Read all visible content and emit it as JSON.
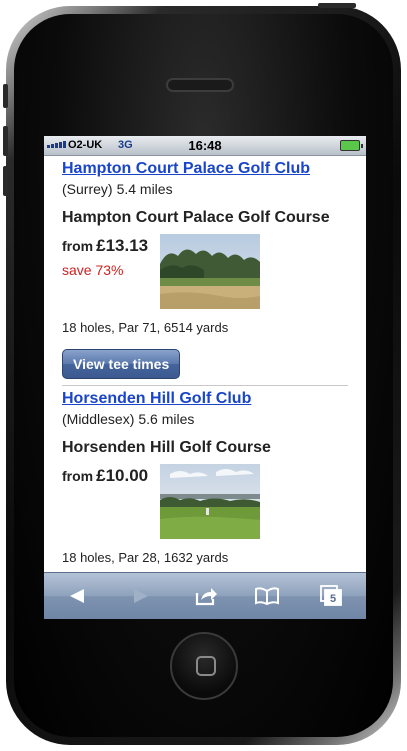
{
  "status_bar": {
    "carrier": "O2-UK",
    "network": "3G",
    "time": "16:48"
  },
  "listings": [
    {
      "club": "Hampton Court Palace Golf Club",
      "region": "(Surrey)",
      "distance": "5.4 miles",
      "course": "Hampton Court Palace Golf Course",
      "price_prefix": "from",
      "price": "£13.13",
      "saving": "save 73%",
      "details": "18 holes, Par 71, 6514 yards",
      "button": "View tee times"
    },
    {
      "club": "Horsenden Hill Golf Club",
      "region": "(Middlesex)",
      "distance": "5.6 miles",
      "course": "Horsenden Hill Golf Course",
      "price_prefix": "from",
      "price": "£10.00",
      "details": "18 holes, Par 28, 1632 yards"
    }
  ],
  "toolbar": {
    "items": [
      "back-icon",
      "forward-icon",
      "share-icon",
      "bookmarks-icon",
      "pages-icon"
    ],
    "pages_count": "5"
  },
  "colors": {
    "link": "#1a45c8",
    "saving": "#d02020",
    "button": "#4a6aa0"
  }
}
